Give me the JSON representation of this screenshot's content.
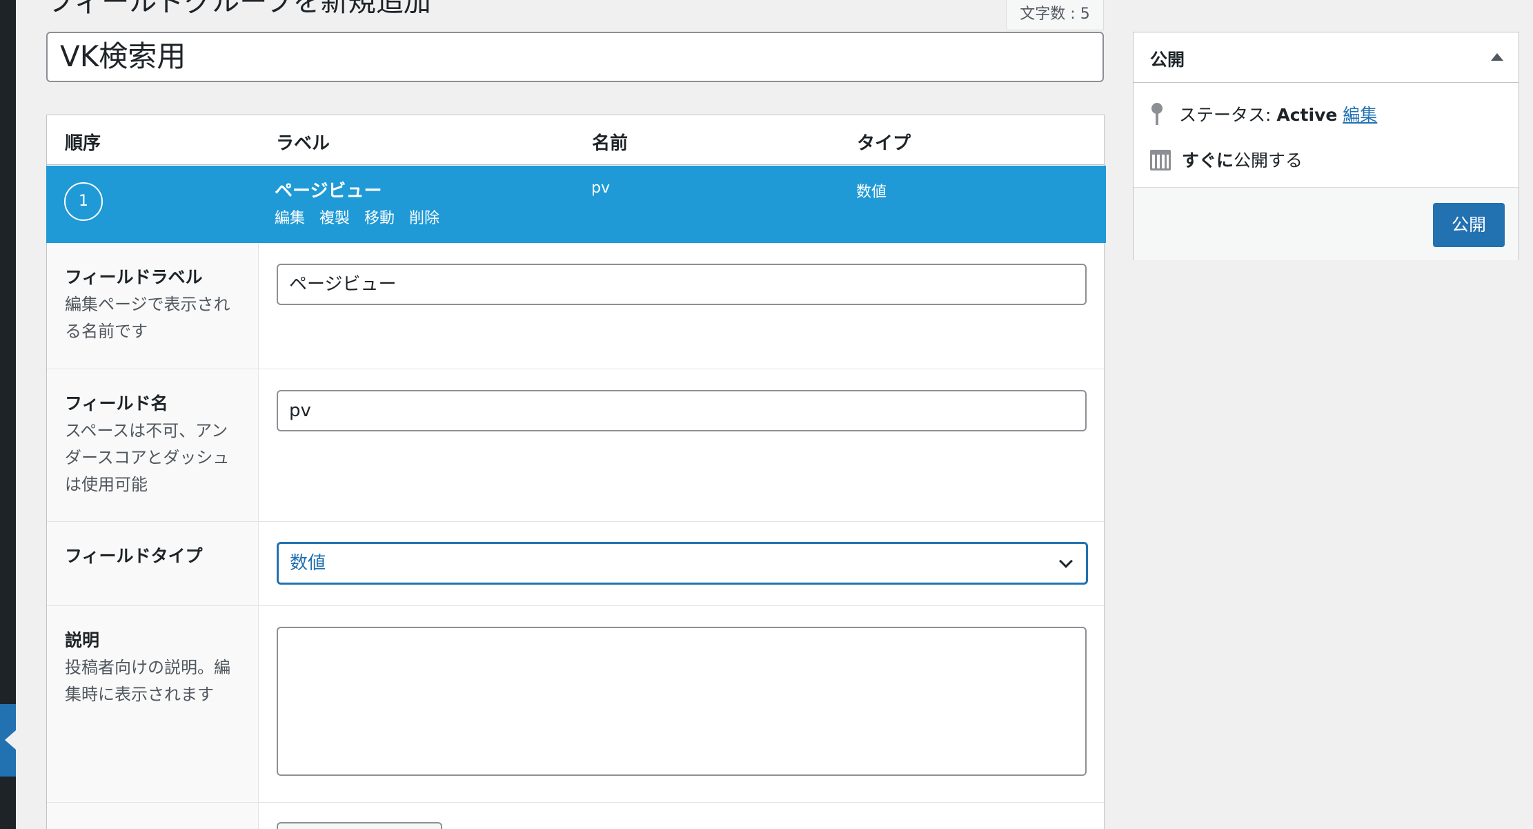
{
  "page": {
    "heading": "フィールドグループを新規追加",
    "char_count": "文字数 : 5",
    "title_value": "VK検索用"
  },
  "fields_table": {
    "columns": [
      "順序",
      "ラベル",
      "名前",
      "タイプ"
    ],
    "row": {
      "order": "1",
      "label": "ページビュー",
      "name": "pv",
      "type": "数値",
      "actions": [
        "編集",
        "複製",
        "移動",
        "削除"
      ]
    }
  },
  "settings": {
    "label": {
      "title": "フィールドラベル",
      "desc": "編集ページで表示される名前です",
      "value": "ページビュー"
    },
    "name": {
      "title": "フィールド名",
      "desc": "スペースは不可、アンダースコアとダッシュは使用可能",
      "value": "pv"
    },
    "type": {
      "title": "フィールドタイプ",
      "value": "数値"
    },
    "description": {
      "title": "説明",
      "desc": "投稿者向けの説明。編集時に表示されます",
      "value": ""
    }
  },
  "publish": {
    "title": "公開",
    "status_label": "ステータス: ",
    "status_value": "Active",
    "status_edit": "編集",
    "schedule_strong": "すぐに",
    "schedule_text": "公開する",
    "button": "公開"
  },
  "colors": {
    "accent": "#2271b1",
    "selected_row": "#1f9ad6"
  }
}
